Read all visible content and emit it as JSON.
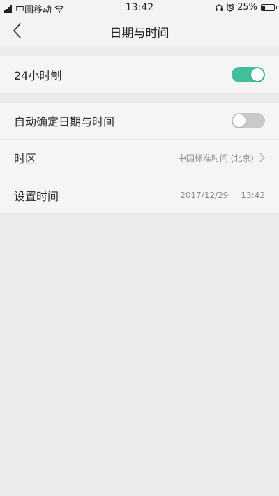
{
  "status_bar": {
    "carrier": "中国移动",
    "time": "13:42",
    "battery": "25%",
    "battery_level": 0.25
  },
  "header": {
    "title": "日期与时间",
    "back_icon": "chevron-left-icon"
  },
  "settings": {
    "hour24": {
      "label": "24小时制",
      "enabled": true
    },
    "auto_datetime": {
      "label": "自动确定日期与时间",
      "enabled": false
    },
    "timezone": {
      "label": "时区",
      "value": "中国标准时间 (北京)"
    },
    "set_time": {
      "label": "设置时间",
      "date": "2017/12/29",
      "time": "13:42"
    }
  },
  "colors": {
    "accent": "#3fbf9c",
    "toggle_off": "#c9c9c9",
    "background": "#ebebeb"
  }
}
